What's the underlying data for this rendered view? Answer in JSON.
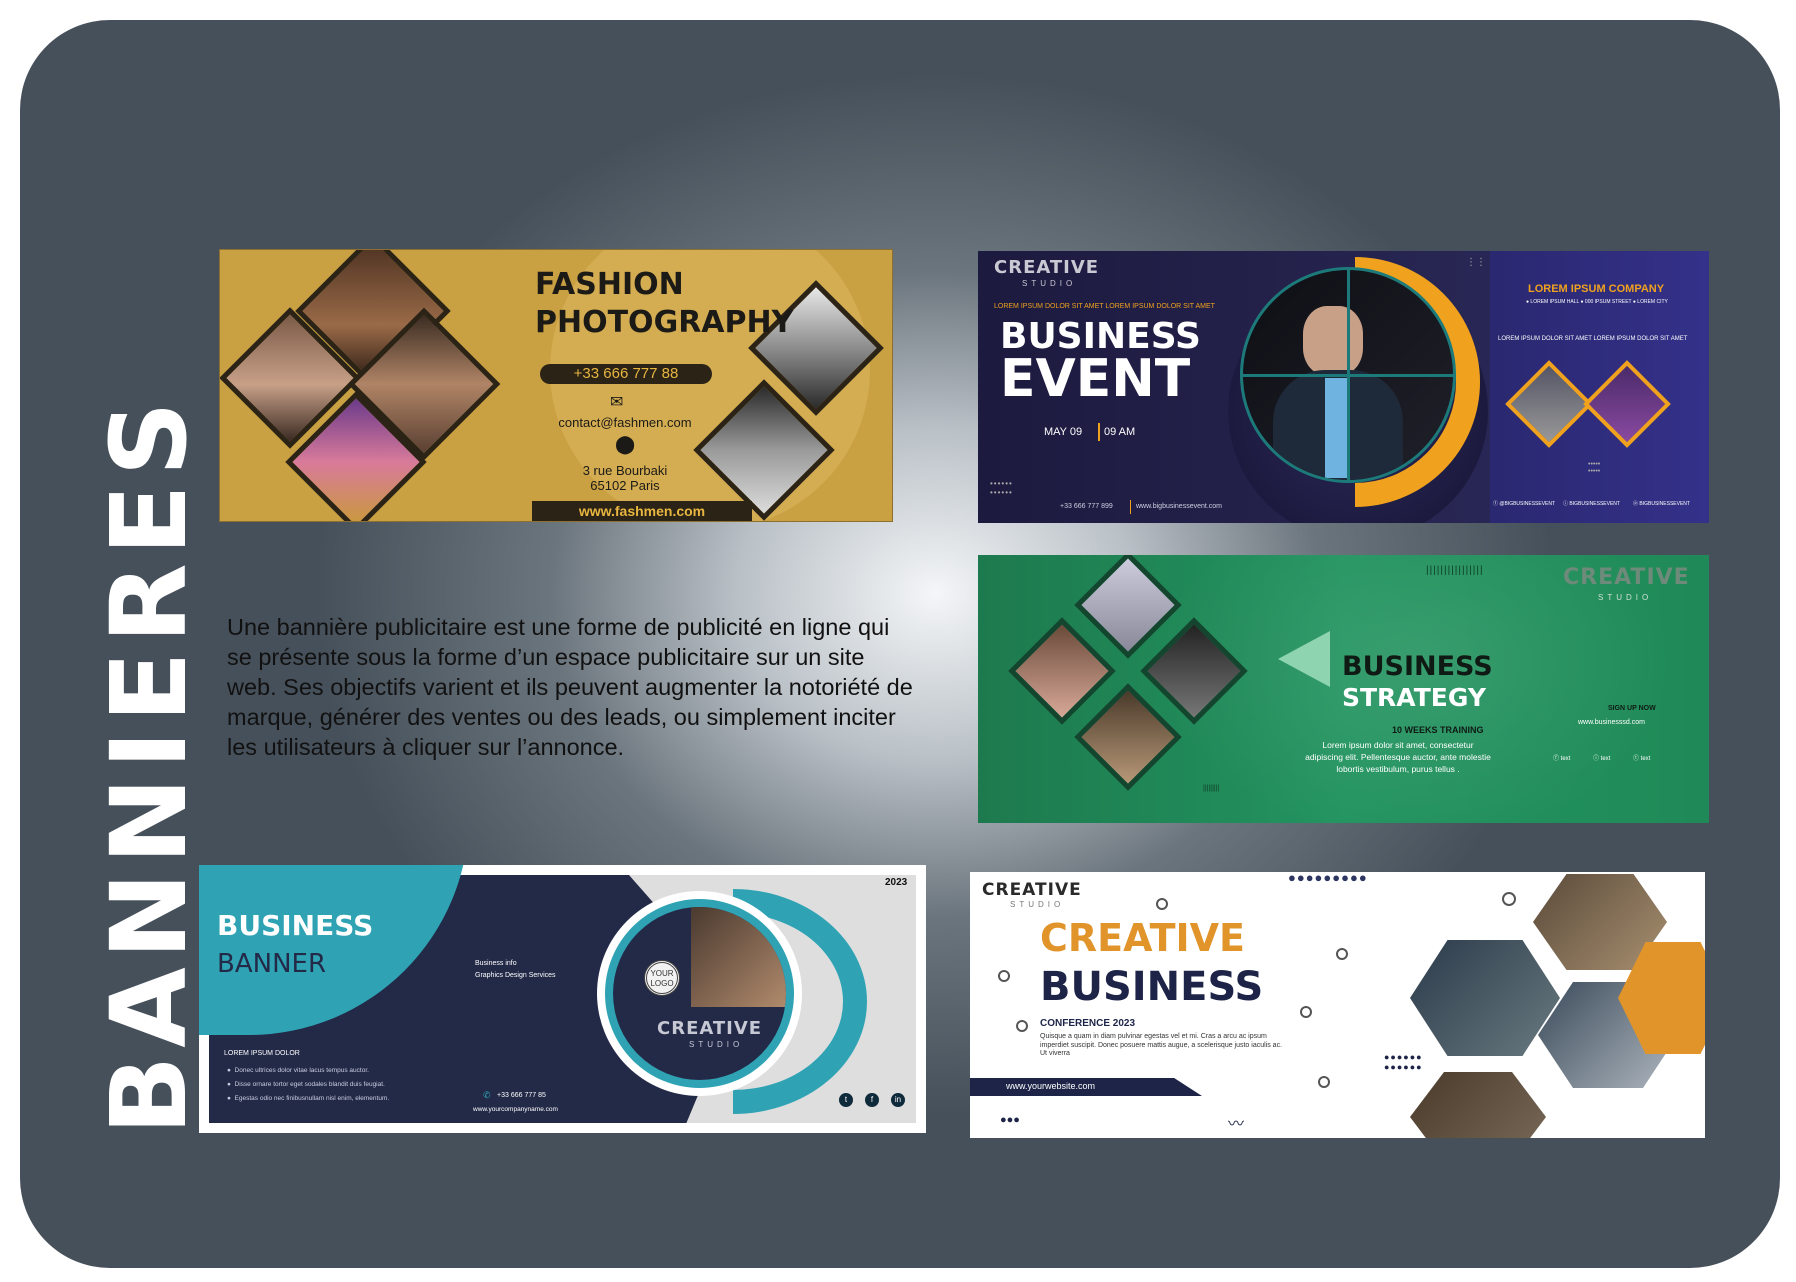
{
  "page": {
    "side_title": "BANNIERES",
    "description": "Une bannière publicitaire est une forme de publicité en ligne qui se présente sous la forme d’un espace publicitaire sur un site web. Ses objectifs varient et ils peuvent augmenter la notoriété de marque, générer des ventes ou des leads, ou simplement inciter les utilisateurs à cliquer sur l’annonce."
  },
  "banners": {
    "fashion": {
      "title_line1": "FASHION",
      "title_line2": "PHOTOGRAPHY",
      "phone": "+33 666 777 88",
      "email": "contact@fashmen.com",
      "address_line1": "3 rue Bourbaki",
      "address_line2": "65102 Paris",
      "website": "www.fashmen.com"
    },
    "event": {
      "logo": "CREATIVE",
      "logo_sub": "STUDIO",
      "tagline": "LOREM IPSUM DOLOR SIT AMET LOREM IPSUM DOLOR SIT AMET",
      "title_line1": "BUSINESS",
      "title_line2": "EVENT",
      "date": "MAY 09",
      "time": "09 AM",
      "phone": "+33 666 777 899",
      "website": "www.bigbusinessevent.com",
      "company": "LOREM IPSUM COMPANY",
      "company_address": "● LOREM IPSUM HALL ● 000 IPSUM STREET ● LOREM CITY",
      "company_text": "LOREM IPSUM DOLOR SIT AMET LOREM IPSUM DOLOR SIT AMET",
      "social": [
        "@BIGBUSINESSEVENT",
        "BIGBUSINESSEVENT",
        "BIGBUSINESSEVENT"
      ]
    },
    "strategy": {
      "logo": "CREATIVE",
      "logo_sub": "STUDIO",
      "title_line1": "BUSINESS",
      "title_line2": "STRATEGY",
      "subtitle": "10 WEEKS TRAINING",
      "body": "Lorem ipsum dolor sit amet, consectetur adipiscing elit. Pellentesque auctor, ante molestie lobortis vestibulum, purus tellus .",
      "signup": "SIGN UP NOW",
      "website": "www.businesssd.com",
      "social": [
        "text",
        "text",
        "text"
      ]
    },
    "business_banner": {
      "year": "2023",
      "title_line1": "BUSINESS",
      "title_line2": "BANNER",
      "info_line1": "Business info",
      "info_line2": "Graphics Design Services",
      "list_title": "LOREM IPSUM DOLOR",
      "bullets": [
        "Donec ultrices dolor vitae lacus tempus auctor.",
        "Disse ornare tortor eget sodales blandit duis feugiat.",
        "Egestas odio nec finibusnullam nisl enim, elementum."
      ],
      "phone": "+33 666 777 85",
      "website": "www.yourcompanyname.com",
      "logo_badge": "LOGO",
      "logo_badge_top": "YOUR",
      "creative": "CREATIVE",
      "creative_sub": "STUDIO"
    },
    "creative_business": {
      "logo": "CREATIVE",
      "logo_sub": "STUDIO",
      "title_line1": "CREATIVE",
      "title_line2": "BUSINESS",
      "subtitle": "CONFERENCE 2023",
      "body": "Quisque a quam in diam pulvinar egestas vel et mi. Cras a arcu ac ipsum imperdiet suscipit. Donec posuere mattis augue, a scelerisque justo iaculis ac. Ut viverra",
      "website": "www.yourwebsite.com"
    }
  },
  "colors": {
    "panel_dark": "#46505a",
    "fashion_gold": "#c9a042",
    "event_navy": "#1c1a3e",
    "event_orange": "#f0a21e",
    "strategy_green": "#1f8a57",
    "banner_teal": "#2fa3b4",
    "banner_navy": "#232a48",
    "creative_orange": "#e0942a",
    "creative_navy": "#1d2447"
  }
}
